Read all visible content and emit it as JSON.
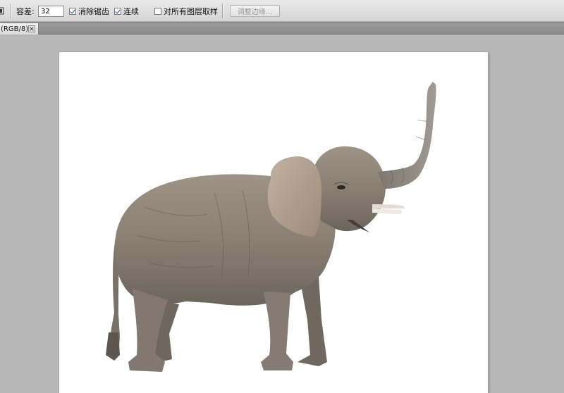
{
  "options_bar": {
    "tolerance_label": "容差:",
    "tolerance_value": "32",
    "anti_alias_label": "消除锯齿",
    "anti_alias_checked": true,
    "contiguous_label": "连续",
    "contiguous_checked": true,
    "sample_all_layers_label": "对所有图层取样",
    "sample_all_layers_checked": false,
    "refine_edge_label": "调整边缘..."
  },
  "document_tab": {
    "label": "(RGB/8)"
  },
  "colors": {
    "workspace": "#b8b8b8",
    "options_bar": "#dedede",
    "canvas": "#ffffff",
    "elephant_skin": "#8c8175"
  }
}
